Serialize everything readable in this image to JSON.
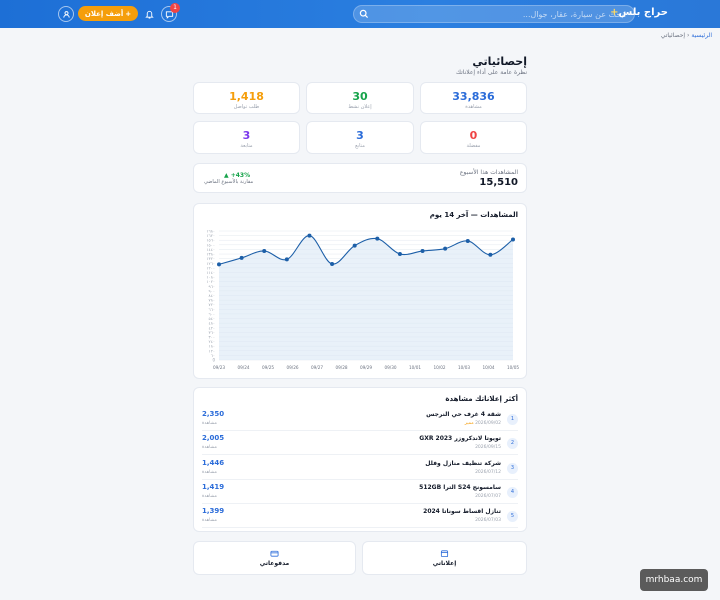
{
  "header": {
    "brand_name": "حراج بلس",
    "brand_plus": "+",
    "search_placeholder": "ابحث عن سيارة، عقار، جوال...",
    "add_ad_label": "أضف إعلان",
    "add_ad_plus": "+",
    "notif_count": "1"
  },
  "breadcrumb": {
    "home": "الرئيسية",
    "sep": "‹",
    "current": "إحصائياتي"
  },
  "page": {
    "title": "إحصائياتي",
    "subtitle": "نظرة عامة على أداء إعلاناتك"
  },
  "stats": [
    {
      "value": "33,836",
      "label": "مشاهدة",
      "color": "#2b6cd9"
    },
    {
      "value": "30",
      "label": "إعلان نشط",
      "color": "#16a34a"
    },
    {
      "value": "1,418",
      "label": "طلب تواصل",
      "color": "#f59e0b"
    },
    {
      "value": "0",
      "label": "مفضلة",
      "color": "#ef4444"
    },
    {
      "value": "3",
      "label": "متابع",
      "color": "#2b6cd9"
    },
    {
      "value": "3",
      "label": "متابعة",
      "color": "#7c3aed"
    }
  ],
  "week": {
    "label": "المشاهدات هذا الأسبوع",
    "value": "15,510",
    "change": "43%+",
    "change_arrow": "▲",
    "change_label": "مقارنة بالأسبوع الماضي"
  },
  "chart_data": {
    "type": "line",
    "title": "المشاهدات — آخر 14 يوم",
    "categories": [
      "09/23",
      "09/24",
      "09/25",
      "09/26",
      "09/27",
      "09/28",
      "09/29",
      "09/30",
      "10/01",
      "10/02",
      "10/03",
      "10/04",
      "10/05"
    ],
    "values": [
      1245,
      1330,
      1420,
      1310,
      1620,
      1250,
      1490,
      1580,
      1380,
      1420,
      1450,
      1550,
      1370,
      1570
    ],
    "ylim": [
      0,
      1680
    ],
    "y_ticks": [
      "0",
      "٦٠",
      "١٢٠",
      "١٨٠",
      "٢٤٠",
      "٣٠٠",
      "٣٦٠",
      "٤٢٠",
      "٤٨٠",
      "٥٤٠",
      "٦٠٠",
      "٦٦٠",
      "٧٢٠",
      "٧٨٠",
      "٨٤٠",
      "٩٠٠",
      "٩٦٠",
      "١٠٢٠",
      "١٠٨٠",
      "١١٤٠",
      "١٢٠٠",
      "١٢٦٠",
      "١٣٢٠",
      "١٣٨٠",
      "١٤٤٠",
      "١٥٠٠",
      "١٥٦٠",
      "١٦٢٠",
      "١٦٨٠"
    ],
    "line_color": "#1d5fa8",
    "fill_color": "#dbe7f5",
    "grid": true
  },
  "top_ads": {
    "title": "أكثر إعلاناتك مشاهدة",
    "views_label": "مشاهدة",
    "items": [
      {
        "rank": "1",
        "name": "شقة 4 غرف حي النرجس",
        "date": "2026/09/02",
        "featured": "مميز",
        "views": "2,350"
      },
      {
        "rank": "2",
        "name": "تويوتا لاندكروزر GXR 2023",
        "date": "2026/09/15",
        "featured": "",
        "views": "2,005"
      },
      {
        "rank": "3",
        "name": "شركة تنظيف منازل وفلل",
        "date": "2026/07/12",
        "featured": "",
        "views": "1,446"
      },
      {
        "rank": "4",
        "name": "سامسونج S24 الترا 512GB",
        "date": "2026/07/07",
        "featured": "",
        "views": "1,419"
      },
      {
        "rank": "5",
        "name": "تنازل اقساط سوناتا 2024",
        "date": "2026/07/03",
        "featured": "",
        "views": "1,399"
      }
    ]
  },
  "bottom_links": {
    "my_ads": "إعلاناتي",
    "my_payments": "مدفوعاتي"
  },
  "watermark": "mrhbaa.com"
}
